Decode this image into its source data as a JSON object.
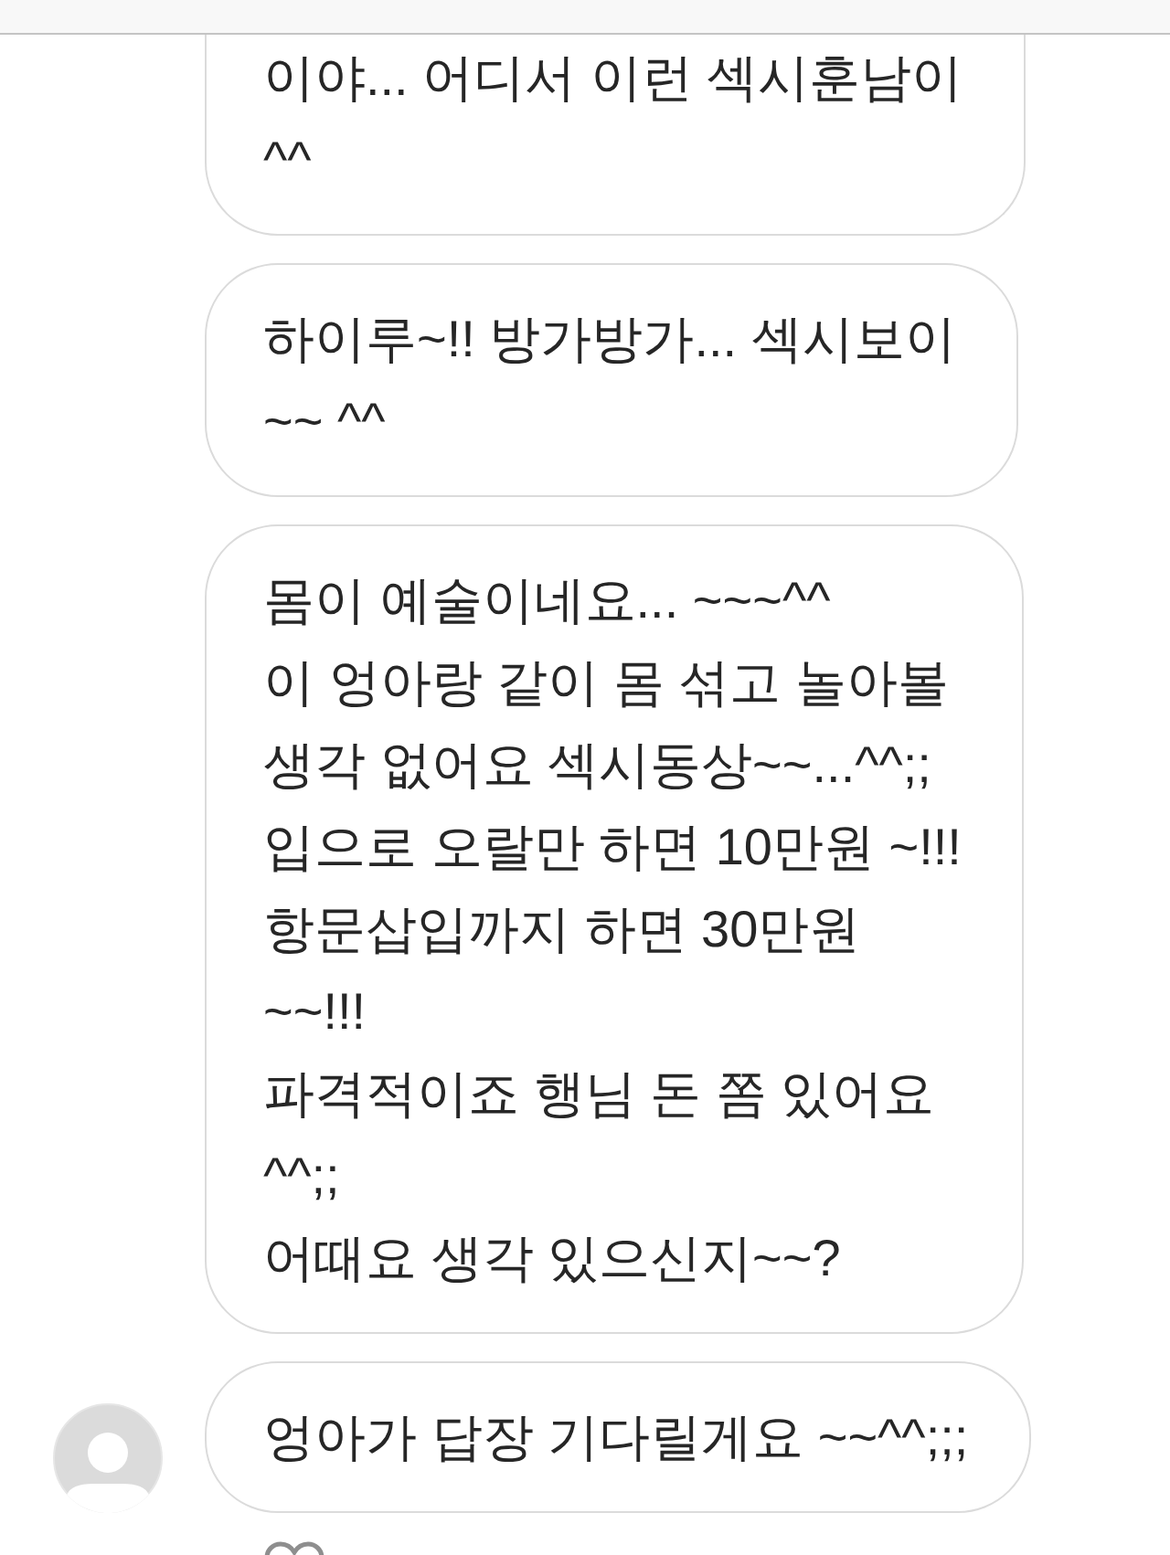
{
  "messages": [
    {
      "lines": [
        "이야... 어디서 이런 섹시훈남이",
        "^^"
      ],
      "avatar": false
    },
    {
      "lines": [
        "하이루~!! 방가방가... 섹시보이",
        "~~ ^^"
      ],
      "avatar": false
    },
    {
      "lines": [
        "몸이 예술이네요... ~~~^^",
        "이 엉아랑 같이 몸 섞고 놀아볼",
        "생각 없어요 섹시동상~~...^^;;",
        "입으로 오랄만 하면 10만원 ~!!!",
        "항문삽입까지 하면 30만원",
        "~~!!!",
        "파격적이죠 행님 돈 쫌 있어요",
        "^^;;",
        "어때요 생각 있으신지~~?"
      ],
      "avatar": false
    },
    {
      "lines": [
        "엉아가 답장 기다릴게요 ~~^^;;;"
      ],
      "avatar": true
    }
  ]
}
